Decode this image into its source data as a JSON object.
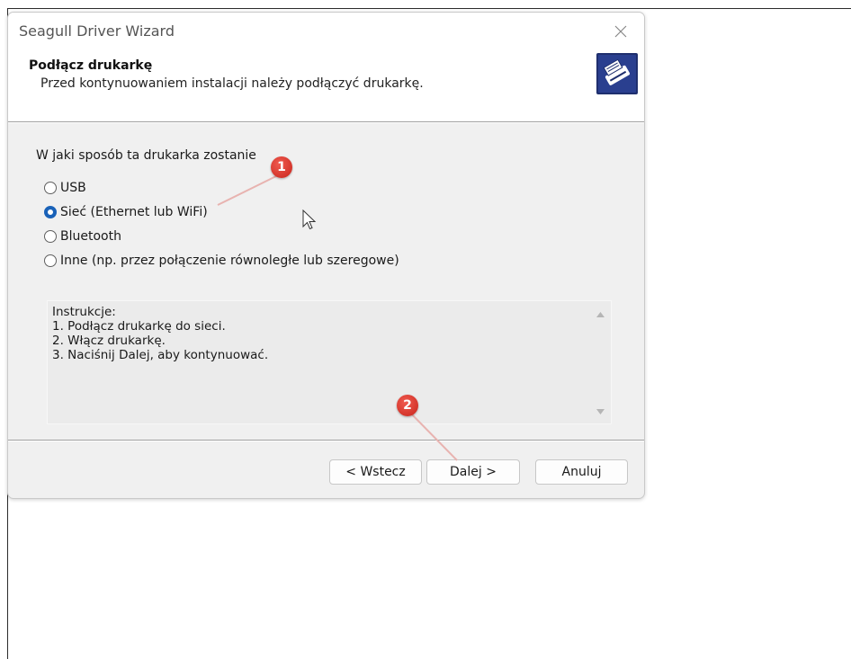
{
  "window": {
    "title": "Seagull Driver Wizard",
    "close_icon": "close-icon"
  },
  "header": {
    "title": "Podłącz drukarkę",
    "subtitle": "Przed kontynuowaniem instalacji należy podłączyć drukarkę.",
    "icon": "printer-icon"
  },
  "connection": {
    "question": "W jaki sposób ta drukarka zostanie",
    "options": [
      {
        "label": "USB",
        "selected": false
      },
      {
        "label": "Sieć (Ethernet lub WiFi)",
        "selected": true
      },
      {
        "label": "Bluetooth",
        "selected": false
      },
      {
        "label": "Inne (np. przez połączenie równoległe lub szeregowe)",
        "selected": false
      }
    ]
  },
  "instructions": {
    "lines": [
      "Instrukcje:",
      "1. Podłącz drukarkę do sieci.",
      "2. Włącz drukarkę.",
      "3. Naciśnij Dalej, aby kontynuować."
    ]
  },
  "buttons": {
    "back": "< Wstecz",
    "next": "Dalej >",
    "cancel": "Anuluj"
  },
  "annotations": {
    "marker1": "1",
    "marker2": "2"
  },
  "colors": {
    "accent": "#1a62b8",
    "marker": "#d9342b"
  }
}
